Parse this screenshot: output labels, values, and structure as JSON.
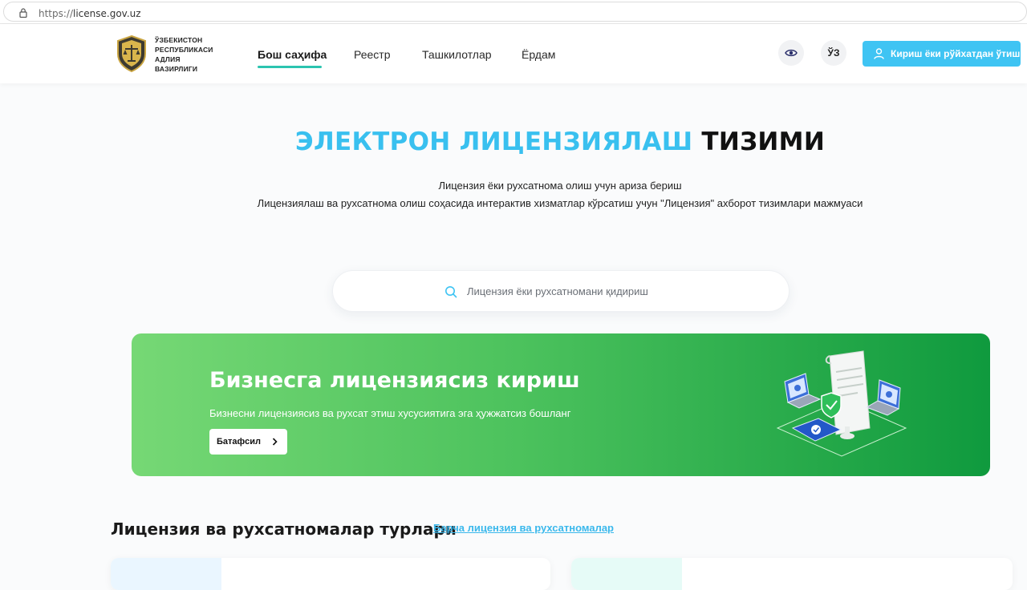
{
  "browser": {
    "url_prefix": "https://",
    "url_host": "license.gov.uz"
  },
  "header": {
    "logo_lines": [
      "ЎЗБЕКИСТОН",
      "РЕСПУБЛИКАСИ",
      "АДЛИЯ",
      "ВАЗИРЛИГИ"
    ],
    "nav": [
      {
        "label": "Бош саҳифа",
        "active": true
      },
      {
        "label": "Реестр",
        "active": false
      },
      {
        "label": "Ташкилотлар",
        "active": false
      },
      {
        "label": "Ёрдам",
        "active": false
      }
    ],
    "lang_label": "ЎЗ",
    "login_label": "Кириш ёки рўйхатдан ўтиш",
    "accent": "#2cc4b0",
    "button_color": "#3fc4f3"
  },
  "hero": {
    "title_blue": "ЭЛЕКТРОН ЛИЦЕНЗИЯЛАШ",
    "title_dark": "ТИЗИМИ",
    "line1": "Лицензия ёки рухсатнома олиш учун ариза бериш",
    "line2": "Лицензиялаш ва рухсатнома олиш соҳасида интерактив хизматлар кўрсатиш учун \"Лицензия\" ахборот тизимлари мажмуаси",
    "search_placeholder": "Лицензия ёки рухсатномани қидириш"
  },
  "banner": {
    "title": "Бизнесга лицензиясиз кириш",
    "subtitle": "Бизнесни лицензиясиз ва рухсат этиш хусусиятига эга ҳужжатсиз бошланг",
    "button_label": "Батафсил",
    "icons": [
      "laptop-icon",
      "document-icon",
      "shield-check-icon",
      "phone-icon"
    ]
  },
  "section": {
    "title": "Лицензия ва рухсатномалар турлари",
    "link_label": "Барча лицензия ва рухсатномалар"
  }
}
